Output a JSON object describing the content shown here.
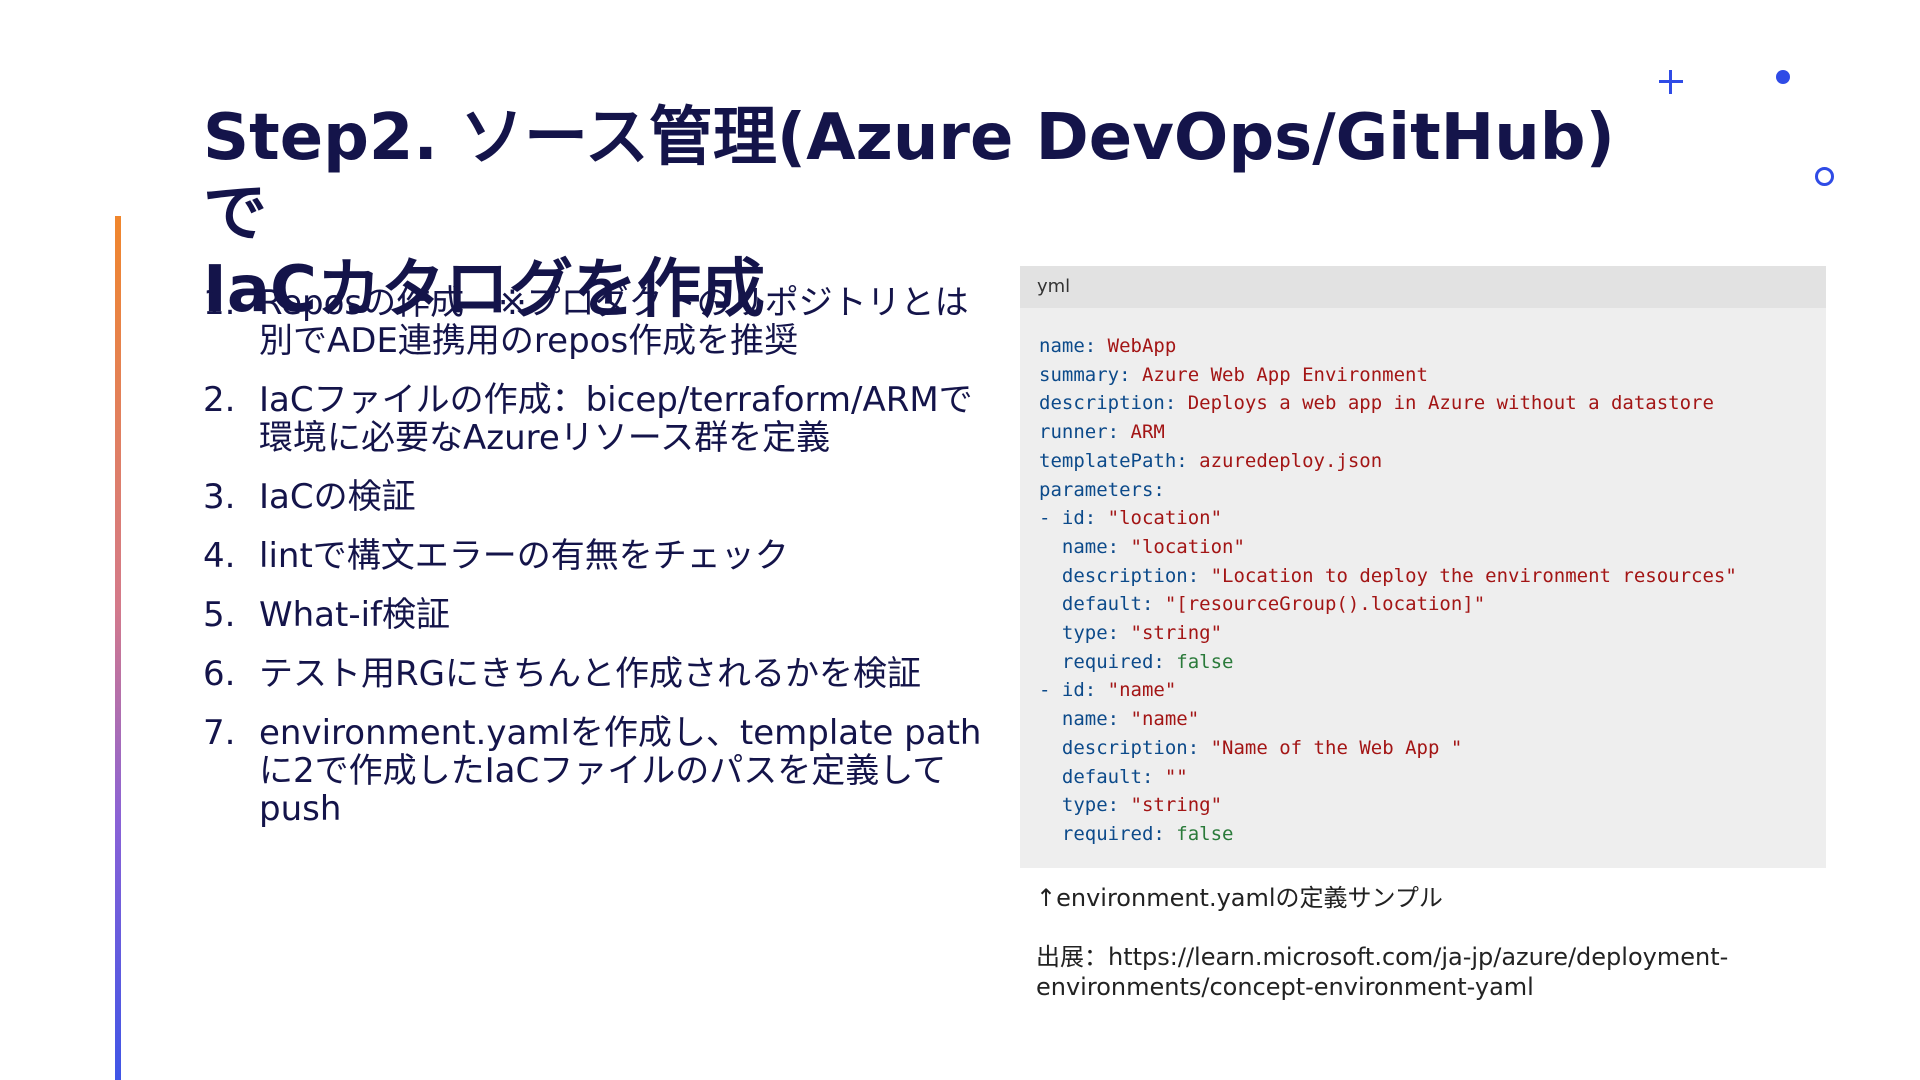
{
  "title": {
    "line1": "Step2. ソース管理(Azure DevOps/GitHub)で",
    "line2": "IaCカタログを作成"
  },
  "steps": [
    {
      "num": "1.",
      "text": "Reposの作成　※プロダクトのリポジトリとは別でADE連携用のrepos作成を推奨"
    },
    {
      "num": "2.",
      "text": "IaCファイルの作成：bicep/terraform/ARMで環境に必要なAzureリソース群を定義"
    },
    {
      "num": "3.",
      "text": "IaCの検証"
    },
    {
      "num": "4.",
      "text": "lintで構文エラーの有無をチェック"
    },
    {
      "num": "5.",
      "text": "What-if検証"
    },
    {
      "num": "6.",
      "text": "テスト用RGにきちんと作成されるかを検証"
    },
    {
      "num": "7.",
      "text": "environment.yamlを作成し、template pathに2で作成したIaCファイルのパスを定義してpush"
    }
  ],
  "code": {
    "lang": "yml",
    "lines": [
      {
        "indent": "",
        "key": "name:",
        "val": " WebApp",
        "type": "s"
      },
      {
        "indent": "",
        "key": "summary:",
        "val": " Azure Web App Environment",
        "type": "s"
      },
      {
        "indent": "",
        "key": "description:",
        "val": " Deploys a web app in Azure without a datastore",
        "type": "s"
      },
      {
        "indent": "",
        "key": "runner:",
        "val": " ARM",
        "type": "s"
      },
      {
        "indent": "",
        "key": "templatePath:",
        "val": " azuredeploy.json",
        "type": "s"
      },
      {
        "indent": "",
        "key": "parameters:",
        "val": "",
        "type": "s"
      },
      {
        "indent": "",
        "key": "- id:",
        "val": " \"location\"",
        "type": "s"
      },
      {
        "indent": "  ",
        "key": "name:",
        "val": " \"location\"",
        "type": "s"
      },
      {
        "indent": "  ",
        "key": "description:",
        "val": " \"Location to deploy the environment resources\"",
        "type": "s"
      },
      {
        "indent": "  ",
        "key": "default:",
        "val": " \"[resourceGroup().location]\"",
        "type": "s"
      },
      {
        "indent": "  ",
        "key": "type:",
        "val": " \"string\"",
        "type": "s"
      },
      {
        "indent": "  ",
        "key": "required:",
        "val": " false",
        "type": "b"
      },
      {
        "indent": "",
        "key": "- id:",
        "val": " \"name\"",
        "type": "s"
      },
      {
        "indent": "  ",
        "key": "name:",
        "val": " \"name\"",
        "type": "s"
      },
      {
        "indent": "  ",
        "key": "description:",
        "val": " \"Name of the Web App \"",
        "type": "s"
      },
      {
        "indent": "  ",
        "key": "default:",
        "val": " \"\"",
        "type": "s"
      },
      {
        "indent": "  ",
        "key": "type:",
        "val": " \"string\"",
        "type": "s"
      },
      {
        "indent": "  ",
        "key": "required:",
        "val": " false",
        "type": "b"
      }
    ]
  },
  "caption": "↑environment.yamlの定義サンプル",
  "source": {
    "line1": "出展：https://learn.microsoft.com/ja-jp/azure/deployment-",
    "line2": "environments/concept-environment-yaml"
  }
}
